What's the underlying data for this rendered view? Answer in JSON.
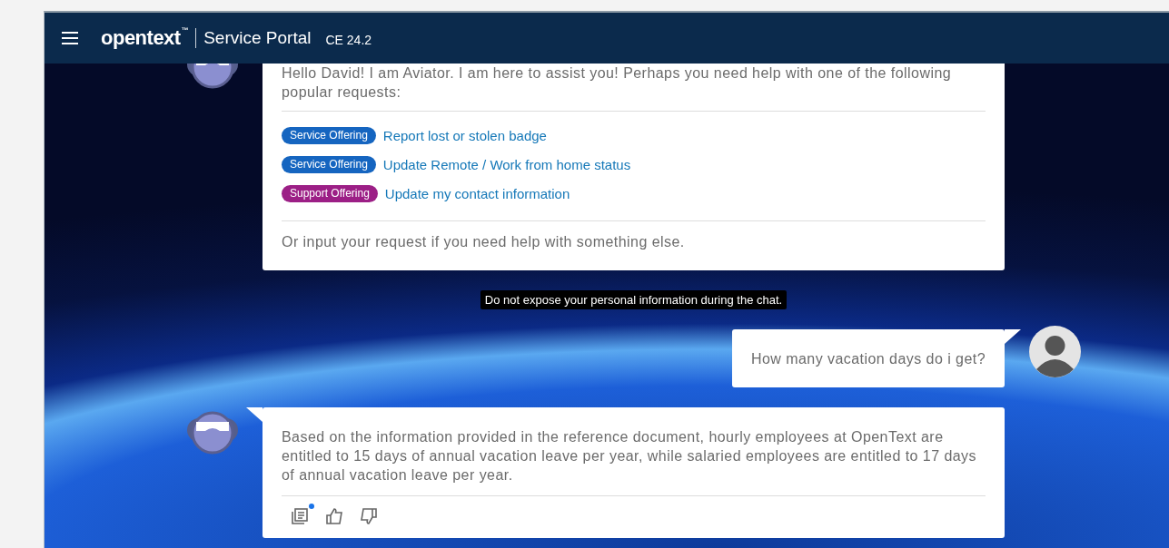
{
  "header": {
    "brand": "opentext",
    "trademark": "™",
    "product": "Service Portal",
    "version": "CE 24.2"
  },
  "messages": [
    {
      "kind": "bot",
      "text": "Hello David! I am Aviator. I am here to assist you! Perhaps you need help with one of the following popular requests:",
      "options": [
        {
          "tag": "Service Offering",
          "color": "#1565c0",
          "link": "Report lost or stolen badge"
        },
        {
          "tag": "Service Offering",
          "color": "#1565c0",
          "link": "Update Remote / Work from home status"
        },
        {
          "tag": "Support Offering",
          "color": "#9c1f86",
          "link": "Update my contact information"
        }
      ],
      "footer": "Or input your request if you need help with something else."
    },
    {
      "kind": "notice",
      "text": "Do not expose your personal information during the chat."
    },
    {
      "kind": "user",
      "text": "How many vacation days do i get?"
    },
    {
      "kind": "bot",
      "text": "Based on the information provided in the reference document, hourly employees at OpenText are entitled to 15 days of annual vacation leave per year, while salaried employees are entitled to 17 days of annual vacation leave per year.",
      "actions": [
        {
          "kind": "references",
          "badge": true
        },
        {
          "kind": "like",
          "badge": false
        },
        {
          "kind": "dislike",
          "badge": false
        }
      ]
    }
  ]
}
